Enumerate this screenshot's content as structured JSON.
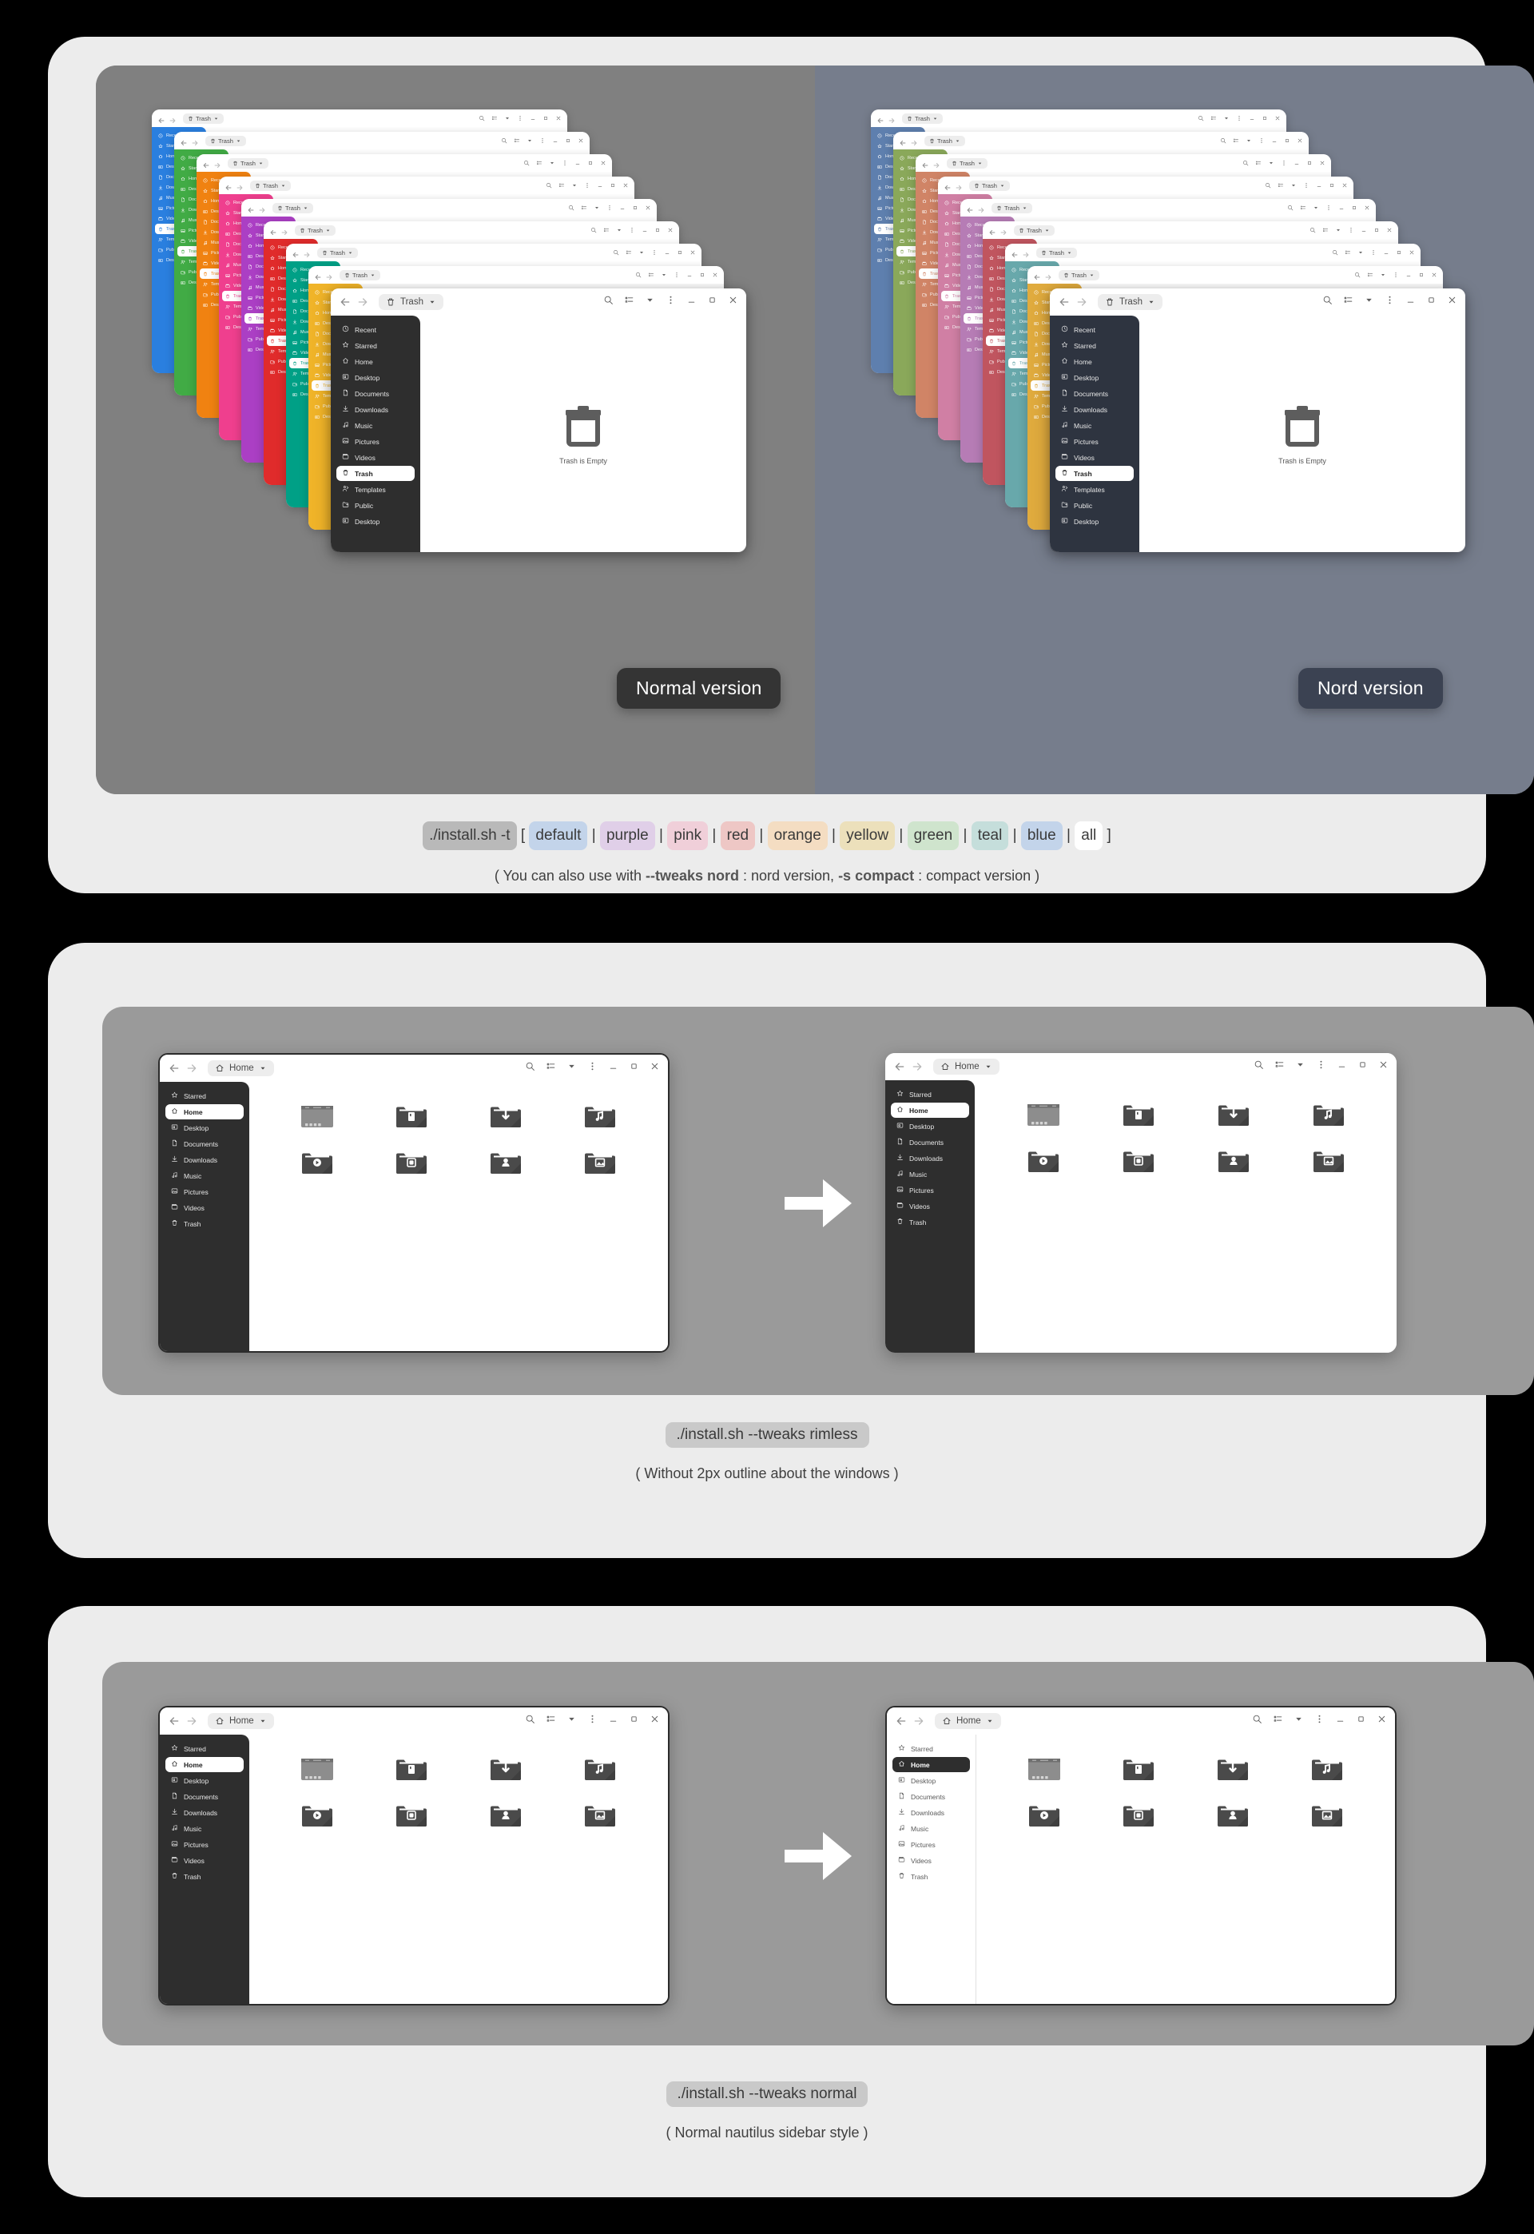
{
  "page": {
    "title": "Colloid GTK Theme — install options"
  },
  "palette": {
    "page_bg": "#000000",
    "card_bg": "#ececec",
    "stage_gray": "#808080",
    "stage_nord": "#767d8c",
    "stage_gray2": "#9a9a9a",
    "sidebar_dark": "#2e2e2e",
    "sidebar_nord": "#2e3440",
    "badge_normal_bg": "#343434",
    "badge_nord_bg": "#3b4252",
    "chip_bg": "#c9c9c9"
  },
  "section1": {
    "badge_normal": "Normal version",
    "badge_nord": "Nord version",
    "command_prefix": "./install.sh -t",
    "bracket_open": "[",
    "bracket_close": "]",
    "separator": "|",
    "variants": [
      {
        "label": "default",
        "chip": "#c3d4ea"
      },
      {
        "label": "purple",
        "chip": "#e0cfe8"
      },
      {
        "label": "pink",
        "chip": "#f0cfd9"
      },
      {
        "label": "red",
        "chip": "#eec7c5"
      },
      {
        "label": "orange",
        "chip": "#f4ddc2"
      },
      {
        "label": "yellow",
        "chip": "#ece0bb"
      },
      {
        "label": "green",
        "chip": "#cfe4cd"
      },
      {
        "label": "teal",
        "chip": "#c5dedb"
      },
      {
        "label": "blue",
        "chip": "#c3d4ea"
      },
      {
        "label": "all",
        "chip": "#ffffff"
      }
    ],
    "note_parts": {
      "pre": "( You can also use with ",
      "b1": "--tweaks nord",
      "mid1": " : nord version,  ",
      "b2": "-s compact",
      "mid2": " : compact version )"
    },
    "stack_normal": [
      "#2e2e2e",
      "#f0b429",
      "#00a086",
      "#e02b2b",
      "#ab3fc4",
      "#ef3f8e",
      "#f08211",
      "#41ab45",
      "#2a7fdf"
    ],
    "stack_nord": [
      "#2e3440",
      "#e0ab3e",
      "#68a8ab",
      "#c0555f",
      "#b67cb5",
      "#d07fa4",
      "#d08466",
      "#8aa85a",
      "#5e7fae"
    ],
    "window": {
      "path_label": "Trash",
      "empty_text": "Trash is Empty",
      "sidebar_items": [
        {
          "label": "Recent",
          "icon": "clock-icon"
        },
        {
          "label": "Starred",
          "icon": "star-icon"
        },
        {
          "label": "Home",
          "icon": "home-icon"
        },
        {
          "label": "Desktop",
          "icon": "desktop-icon"
        },
        {
          "label": "Documents",
          "icon": "document-icon"
        },
        {
          "label": "Downloads",
          "icon": "download-icon"
        },
        {
          "label": "Music",
          "icon": "music-icon"
        },
        {
          "label": "Pictures",
          "icon": "picture-icon"
        },
        {
          "label": "Videos",
          "icon": "video-icon"
        },
        {
          "label": "Trash",
          "icon": "trash-icon",
          "selected": true
        },
        {
          "label": "Templates",
          "icon": "templates-icon"
        },
        {
          "label": "Public",
          "icon": "public-icon"
        },
        {
          "label": "Desktop",
          "icon": "desktop-icon"
        }
      ]
    }
  },
  "section2": {
    "command": "./install.sh --tweaks rimless",
    "note": "( Without 2px outline about the windows )",
    "left_window": {
      "path_label": "Home",
      "outlined": true
    },
    "right_window": {
      "path_label": "Home",
      "outlined": false
    },
    "sidebar_items": [
      {
        "label": "Starred",
        "icon": "star-icon"
      },
      {
        "label": "Home",
        "icon": "home-icon",
        "selected": true
      },
      {
        "label": "Desktop",
        "icon": "desktop-icon"
      },
      {
        "label": "Documents",
        "icon": "document-icon"
      },
      {
        "label": "Downloads",
        "icon": "download-icon"
      },
      {
        "label": "Music",
        "icon": "music-icon"
      },
      {
        "label": "Pictures",
        "icon": "picture-icon"
      },
      {
        "label": "Videos",
        "icon": "video-icon"
      },
      {
        "label": "Trash",
        "icon": "trash-icon"
      }
    ],
    "folder_icons": [
      "desktop-folder-icon",
      "documents-folder-icon",
      "downloads-folder-icon",
      "music-folder-icon",
      "videos-folder-icon",
      "screenshots-folder-icon",
      "public-folder-icon",
      "pictures-folder-icon"
    ]
  },
  "section3": {
    "command": "./install.sh --tweaks normal",
    "note": "( Normal nautilus sidebar style )",
    "left_window": {
      "path_label": "Home",
      "sidebar_style": "dark"
    },
    "right_window": {
      "path_label": "Home",
      "sidebar_style": "light"
    },
    "sidebar_items": [
      {
        "label": "Starred",
        "icon": "star-icon"
      },
      {
        "label": "Home",
        "icon": "home-icon",
        "selected": true
      },
      {
        "label": "Desktop",
        "icon": "desktop-icon"
      },
      {
        "label": "Documents",
        "icon": "document-icon"
      },
      {
        "label": "Downloads",
        "icon": "download-icon"
      },
      {
        "label": "Music",
        "icon": "music-icon"
      },
      {
        "label": "Pictures",
        "icon": "picture-icon"
      },
      {
        "label": "Videos",
        "icon": "video-icon"
      },
      {
        "label": "Trash",
        "icon": "trash-icon"
      }
    ],
    "folder_icons": [
      "desktop-folder-icon",
      "documents-folder-icon",
      "downloads-folder-icon",
      "music-folder-icon",
      "videos-folder-icon",
      "screenshots-folder-icon",
      "public-folder-icon",
      "pictures-folder-icon"
    ]
  },
  "header_icons": [
    "search-icon",
    "list-view-icon",
    "chevron-down-icon",
    "menu-dots-icon",
    "minimize-icon",
    "maximize-icon",
    "close-icon"
  ]
}
